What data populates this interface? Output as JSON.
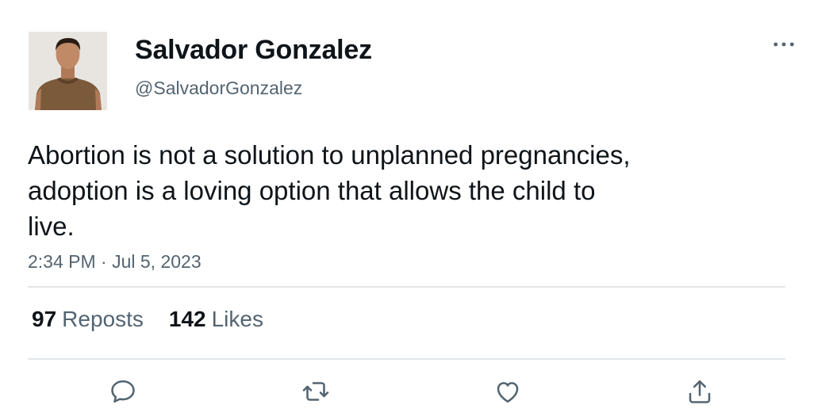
{
  "author": {
    "display_name": "Salvador Gonzalez",
    "handle": "@SalvadorGonzalez"
  },
  "tweet": {
    "text": "Abortion is not a solution to unplanned pregnancies,\nadoption is a loving option that allows the child to\nlive.",
    "timestamp": "2:34 PM · Jul 5, 2023"
  },
  "stats": {
    "reposts_count": "97",
    "reposts_label": "Reposts",
    "likes_count": "142",
    "likes_label": "Likes"
  },
  "icons": {
    "more": "more-horizontal-icon",
    "reply": "reply-icon",
    "repost": "repost-icon",
    "like": "heart-icon",
    "share": "share-icon"
  },
  "colors": {
    "text_primary": "#0f1419",
    "text_secondary": "#536471",
    "divider": "#e3e7ea"
  }
}
